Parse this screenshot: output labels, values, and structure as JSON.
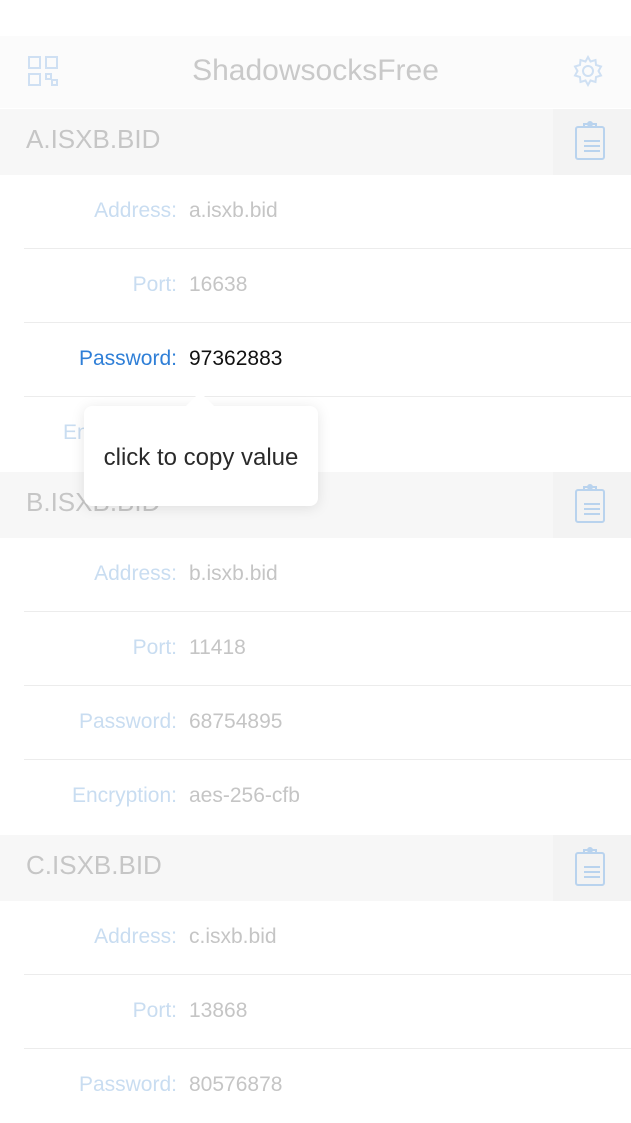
{
  "app": {
    "title": "ShadowsocksFree",
    "icons": {
      "left": "qr-code-icon",
      "right": "gear-icon"
    }
  },
  "labels": {
    "address": "Address:",
    "port": "Port:",
    "password": "Password:",
    "encryption": "Encryption:"
  },
  "servers": [
    {
      "name": "A.ISXB.BID",
      "address": "a.isxb.bid",
      "port": "16638",
      "password": "97362883",
      "encryption_partial": "En"
    },
    {
      "name": "B.ISXB.BID",
      "address": "b.isxb.bid",
      "port": "11418",
      "password": "68754895",
      "encryption": "aes-256-cfb"
    },
    {
      "name": "C.ISXB.BID",
      "address": "c.isxb.bid",
      "port": "13868",
      "password": "80576878"
    }
  ],
  "tooltip": {
    "text": "click to copy value"
  },
  "colors": {
    "accent": "#2f7fd7",
    "faded_label": "#c9ddf1",
    "faded_value": "#c5c5c5",
    "section_bg": "#f7f7f7"
  }
}
